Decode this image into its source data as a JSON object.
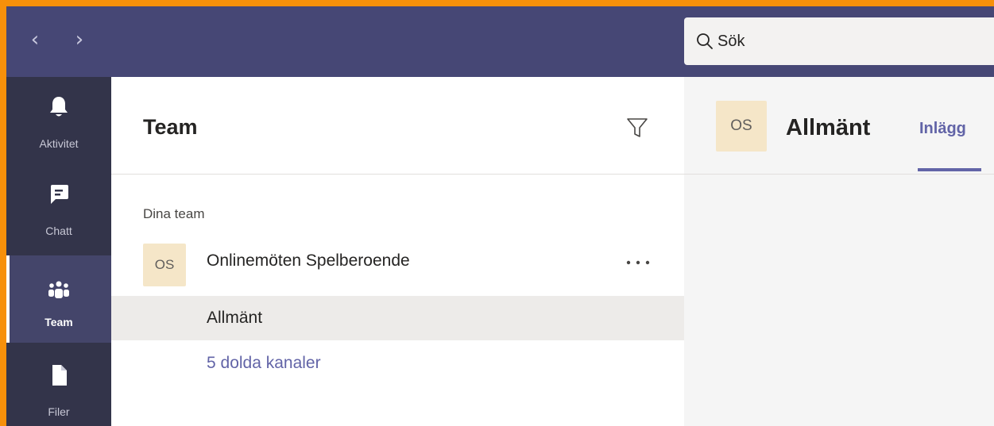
{
  "topbar": {
    "back_icon": "chevron-left-icon",
    "forward_icon": "chevron-right-icon",
    "search": {
      "placeholder": "Sök",
      "value": ""
    }
  },
  "rail": {
    "items": [
      {
        "label": "Aktivitet",
        "icon": "bell-icon",
        "active": false
      },
      {
        "label": "Chatt",
        "icon": "chat-icon",
        "active": false
      },
      {
        "label": "Team",
        "icon": "team-icon",
        "active": true
      },
      {
        "label": "Filer",
        "icon": "file-icon",
        "active": false
      }
    ]
  },
  "teams_panel": {
    "title": "Team",
    "filter_icon": "filter-icon",
    "section_label": "Dina team",
    "team": {
      "avatar_initials": "OS",
      "name": "Onlinemöten Spelberoende",
      "more_icon": "more-options-icon"
    },
    "channels": [
      {
        "name": "Allmänt",
        "selected": true
      }
    ],
    "hidden_channels_link": "5 dolda kanaler"
  },
  "content": {
    "avatar_initials": "OS",
    "channel_title": "Allmänt",
    "tabs": [
      {
        "label": "Inlägg",
        "active": true
      }
    ]
  },
  "colors": {
    "frame_border": "#f7900a",
    "topbar": "#464775",
    "rail": "#33344a",
    "accent": "#6264a7",
    "avatar_bg": "#f5e6c8"
  }
}
